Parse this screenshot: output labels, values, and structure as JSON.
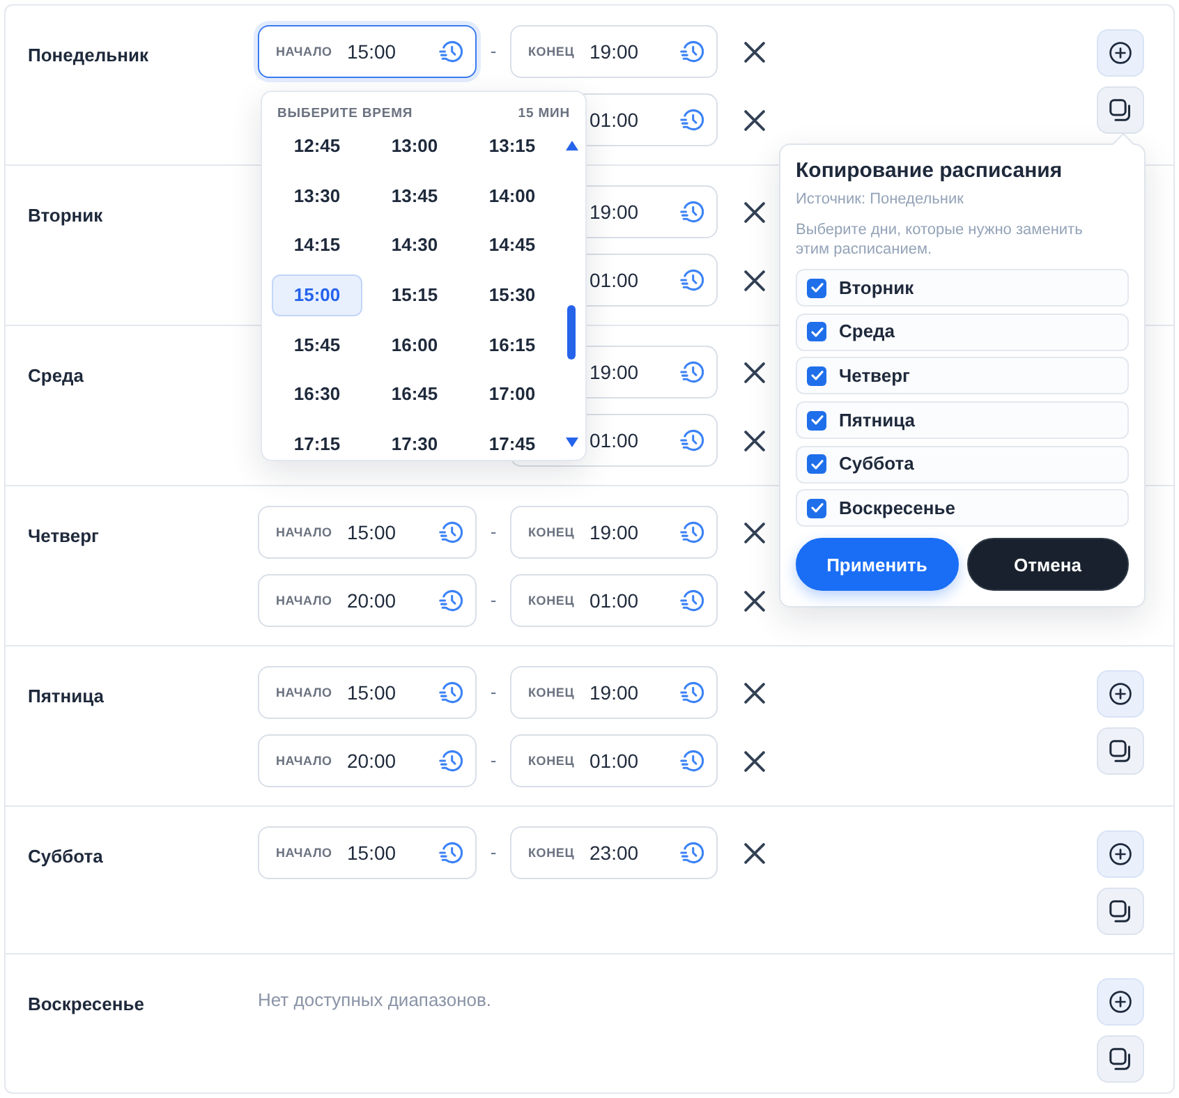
{
  "days": [
    {
      "name": "Понедельник",
      "ranges": [
        {
          "start": {
            "label": "НАЧАЛО",
            "value": "15:00",
            "focused": true
          },
          "separator": "-",
          "end": {
            "label": "КОНЕЦ",
            "value": "19:00",
            "focused": false
          }
        },
        {
          "end": {
            "value": "01:00",
            "focused": false
          }
        }
      ],
      "actions": [
        {
          "kind": "add"
        },
        {
          "kind": "copy"
        }
      ]
    },
    {
      "name": "Вторник",
      "ranges": [
        {
          "end": {
            "value": "19:00",
            "focused": false
          }
        },
        {
          "end": {
            "value": "01:00",
            "focused": false
          }
        }
      ]
    },
    {
      "name": "Среда",
      "ranges": [
        {
          "end": {
            "value": "19:00",
            "focused": false
          }
        },
        {
          "end": {
            "value": "01:00",
            "focused": false
          }
        }
      ]
    },
    {
      "name": "Четверг",
      "ranges": [
        {
          "start": {
            "label": "НАЧАЛО",
            "value": "15:00",
            "focused": false
          },
          "separator": "-",
          "end": {
            "label": "КОНЕЦ",
            "value": "19:00",
            "focused": false
          }
        },
        {
          "start": {
            "label": "НАЧАЛО",
            "value": "20:00",
            "focused": false
          },
          "separator": "-",
          "end": {
            "label": "КОНЕЦ",
            "value": "01:00",
            "focused": false
          }
        }
      ]
    },
    {
      "name": "Пятница",
      "ranges": [
        {
          "start": {
            "label": "НАЧАЛО",
            "value": "15:00",
            "focused": false
          },
          "separator": "-",
          "end": {
            "label": "КОНЕЦ",
            "value": "19:00",
            "focused": false
          }
        },
        {
          "start": {
            "label": "НАЧАЛО",
            "value": "20:00",
            "focused": false
          },
          "separator": "-",
          "end": {
            "label": "КОНЕЦ",
            "value": "01:00",
            "focused": false
          }
        }
      ],
      "actions": [
        {
          "kind": "add"
        },
        {
          "kind": "copy"
        }
      ]
    },
    {
      "name": "Суббота",
      "ranges": [
        {
          "start": {
            "label": "НАЧАЛО",
            "value": "15:00",
            "focused": false
          },
          "separator": "-",
          "end": {
            "label": "КОНЕЦ",
            "value": "23:00",
            "focused": false
          }
        }
      ],
      "actions": [
        {
          "kind": "add"
        },
        {
          "kind": "copy"
        }
      ]
    },
    {
      "name": "Воскресенье",
      "empty_text": "Нет доступных диапазонов.",
      "actions": [
        {
          "kind": "add"
        },
        {
          "kind": "copy"
        }
      ]
    }
  ],
  "time_picker": {
    "title": "ВЫБЕРИТЕ ВРЕМЯ",
    "step": "15 МИН",
    "times": [
      {
        "label": "12:45",
        "selected": false
      },
      {
        "label": "13:00",
        "selected": false
      },
      {
        "label": "13:15",
        "selected": false
      },
      {
        "label": "13:30",
        "selected": false
      },
      {
        "label": "13:45",
        "selected": false
      },
      {
        "label": "14:00",
        "selected": false
      },
      {
        "label": "14:15",
        "selected": false
      },
      {
        "label": "14:30",
        "selected": false
      },
      {
        "label": "14:45",
        "selected": false
      },
      {
        "label": "15:00",
        "selected": true
      },
      {
        "label": "15:15",
        "selected": false
      },
      {
        "label": "15:30",
        "selected": false
      },
      {
        "label": "15:45",
        "selected": false
      },
      {
        "label": "16:00",
        "selected": false
      },
      {
        "label": "16:15",
        "selected": false
      },
      {
        "label": "16:30",
        "selected": false
      },
      {
        "label": "16:45",
        "selected": false
      },
      {
        "label": "17:00",
        "selected": false
      },
      {
        "label": "17:15",
        "selected": false
      },
      {
        "label": "17:30",
        "selected": false
      },
      {
        "label": "17:45",
        "selected": false
      }
    ]
  },
  "copy_popover": {
    "title": "Копирование расписания",
    "source": "Источник: Понедельник",
    "description": "Выберите дни, которые нужно заменить этим расписанием.",
    "days": [
      {
        "label": "Вторник",
        "checked": true
      },
      {
        "label": "Среда",
        "checked": true
      },
      {
        "label": "Четверг",
        "checked": true
      },
      {
        "label": "Пятница",
        "checked": true
      },
      {
        "label": "Суббота",
        "checked": true
      },
      {
        "label": "Воскресенье",
        "checked": true
      }
    ],
    "buttons": [
      {
        "label": "Применить",
        "kind": "primary"
      },
      {
        "label": "Отмена",
        "kind": "secondary"
      }
    ]
  }
}
